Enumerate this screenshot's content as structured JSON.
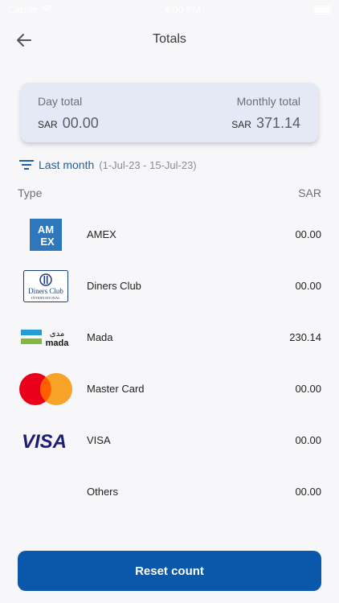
{
  "status_bar": {
    "carrier": "Carrier",
    "time": "4:00 PM"
  },
  "header": {
    "title": "Totals"
  },
  "totals": {
    "day_label": "Day total",
    "day_currency": "SAR",
    "day_value": "00.00",
    "month_label": "Monthly total",
    "month_currency": "SAR",
    "month_value": "371.14"
  },
  "filter": {
    "period": "Last month",
    "range": "(1-Jul-23 - 15-Jul-23)"
  },
  "table": {
    "col_type": "Type",
    "col_amount": "SAR",
    "rows": [
      {
        "name": "AMEX",
        "amount": "00.00",
        "logo": "amex-logo"
      },
      {
        "name": "Diners Club",
        "amount": "00.00",
        "logo": "diners-club-logo"
      },
      {
        "name": "Mada",
        "amount": "230.14",
        "logo": "mada-logo"
      },
      {
        "name": "Master Card",
        "amount": "00.00",
        "logo": "mastercard-logo"
      },
      {
        "name": "VISA",
        "amount": "00.00",
        "logo": "visa-logo"
      },
      {
        "name": "Others",
        "amount": "00.00",
        "logo": ""
      }
    ]
  },
  "logos": {
    "amex_text": "AMEX",
    "diners_text_1": "Diners Club",
    "diners_text_2": "INTERNATIONAL",
    "mada_text": "mada",
    "mada_arabic": "مدى",
    "visa_text": "VISA"
  },
  "actions": {
    "reset_label": "Reset count"
  },
  "colors": {
    "primary": "#0a58a9",
    "card_bg": "#e5e9f6",
    "link": "#1f5fa3",
    "amex_blue": "#2e77bb",
    "mastercard_red": "#eb001b",
    "mastercard_orange": "#f79e1b",
    "visa_blue": "#1a1f71",
    "mada_blue": "#259bd6",
    "mada_green": "#84b740"
  }
}
